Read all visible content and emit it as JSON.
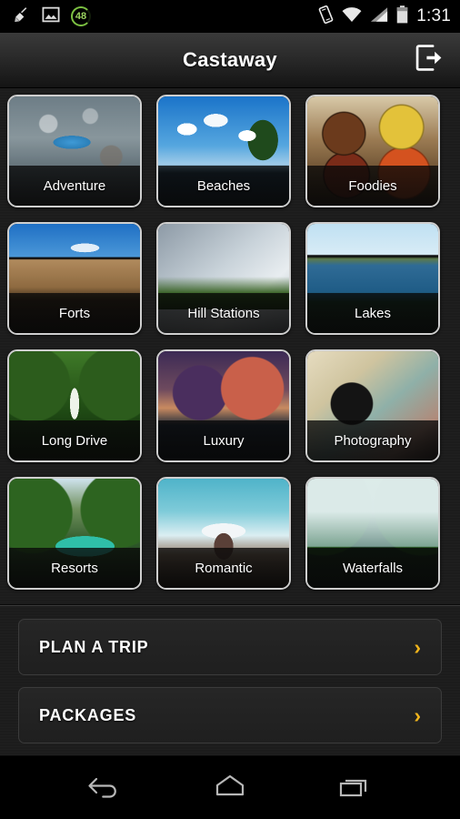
{
  "status_bar": {
    "icons": [
      {
        "name": "broom-clean-icon",
        "glyph": "broom"
      },
      {
        "name": "gallery-image-icon",
        "glyph": "image"
      },
      {
        "name": "battery-percent-badge",
        "glyph": "48"
      }
    ],
    "badge_value": "48",
    "right_icons": [
      {
        "name": "vibrate-icon"
      },
      {
        "name": "wifi-icon"
      },
      {
        "name": "cell-signal-icon"
      },
      {
        "name": "battery-icon"
      }
    ],
    "time": "1:31"
  },
  "app_bar": {
    "title": "Castaway",
    "logout_icon": "logout-icon"
  },
  "tiles": [
    {
      "label": "Adventure",
      "art": "ph-adventure"
    },
    {
      "label": "Beaches",
      "art": "ph-beaches"
    },
    {
      "label": "Foodies",
      "art": "ph-foodies"
    },
    {
      "label": "Forts",
      "art": "ph-forts"
    },
    {
      "label": "Hill Stations",
      "art": "ph-hill"
    },
    {
      "label": "Lakes",
      "art": "ph-lakes"
    },
    {
      "label": "Long Drive",
      "art": "ph-longdrive"
    },
    {
      "label": "Luxury",
      "art": "ph-luxury"
    },
    {
      "label": "Photography",
      "art": "ph-photography"
    },
    {
      "label": "Resorts",
      "art": "ph-resorts"
    },
    {
      "label": "Romantic",
      "art": "ph-romantic"
    },
    {
      "label": "Waterfalls",
      "art": "ph-waterfalls"
    }
  ],
  "list_buttons": [
    {
      "label": "PLAN A TRIP",
      "chevron": "›"
    },
    {
      "label": "PACKAGES",
      "chevron": "›"
    }
  ],
  "nav_bar": {
    "back": "back-icon",
    "home": "home-icon",
    "recents": "recents-icon"
  },
  "colors": {
    "accent_chevron": "#F0B41C",
    "page_background": "#1C1C1C",
    "tile_border": "#CFCFCF",
    "badge_green": "#7CC142",
    "text_primary": "#FFFFFF"
  }
}
